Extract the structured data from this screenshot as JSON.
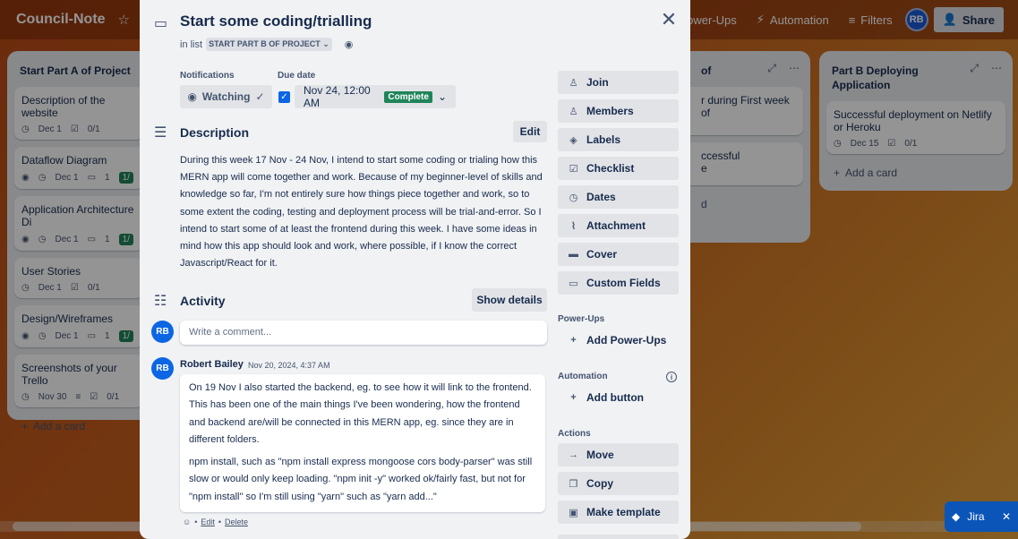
{
  "board": {
    "title": "Council-Note",
    "header_items": [
      "Power-Ups",
      "Automation",
      "Filters"
    ],
    "avatar": "RB",
    "share_label": "Share"
  },
  "lists": [
    {
      "title": "Start Part A of Project",
      "cards": [
        {
          "title": "Description of the website",
          "date": "Dec 1",
          "check": "0/1",
          "watch": false,
          "comments": "",
          "green": ""
        },
        {
          "title": "Dataflow Diagram",
          "date": "Dec 1",
          "check": "",
          "watch": true,
          "comments": "1",
          "green": "1/"
        },
        {
          "title": "Application Architecture Di",
          "date": "Dec 1",
          "check": "",
          "watch": true,
          "comments": "1",
          "green": "1/"
        },
        {
          "title": "User Stories",
          "date": "Dec 1",
          "check": "0/1",
          "watch": false,
          "comments": "",
          "green": ""
        },
        {
          "title": "Design/Wireframes",
          "date": "Dec 1",
          "check": "",
          "watch": true,
          "comments": "1",
          "green": "1/"
        },
        {
          "title": "Screenshots of your Trello",
          "date": "Nov 30",
          "check": "0/1",
          "watch": false,
          "comments": "",
          "green": ""
        }
      ],
      "add_card": "Add a card"
    },
    {
      "title": "of",
      "cards": [
        {
          "title": "r during First week of"
        },
        {
          "title": "ccessful\ne"
        }
      ],
      "add_card": "d"
    },
    {
      "title": "Part B Deploying Application",
      "cards": [
        {
          "title": "Successful deployment on Netlify or Heroku",
          "date": "Dec 15",
          "check": "0/1"
        }
      ],
      "add_card": "Add a card"
    }
  ],
  "jira": {
    "label": "Jira"
  },
  "modal": {
    "title": "Start some coding/trialling",
    "in_list_prefix": "in list",
    "list_name": "START PART B OF PROJECT",
    "notifications_label": "Notifications",
    "watching_label": "Watching",
    "due_label": "Due date",
    "due_value": "Nov 24, 12:00 AM",
    "due_status": "Complete",
    "description_title": "Description",
    "edit_label": "Edit",
    "description": "During this week 17 Nov - 24 Nov, I intend to start some coding or trialing how this MERN app will come together and work. Because of my beginner-level of skills and knowledge so far, I'm not entirely sure how things piece together and work, so to some extent the coding, testing and deployment process will be trial-and-error. So I intend to start some of at least the frontend during this week. I have some ideas in mind how this app should look and work, where possible, if I know the correct Javascript/React for it.",
    "activity_title": "Activity",
    "show_details_label": "Show details",
    "comment_placeholder": "Write a comment...",
    "avatar_initials": "RB",
    "comment": {
      "author": "Robert Bailey",
      "time": "Nov 20, 2024, 4:37 AM",
      "p1": "On 19 Nov I also started the backend, eg. to see how it will link to the frontend. This has been one of the main things I've been wondering, how the frontend and backend are/will be connected in this MERN app, eg. since they are in different folders.",
      "p2": "npm install, such as \"npm install express mongoose cors body-parser\" was still slow or would only keep loading. \"npm init -y\" worked ok/fairly fast, but not for \"npm install\" so I'm still using \"yarn\" such as \"yarn add...\"",
      "edit": "Edit",
      "delete": "Delete",
      "bullet": "•"
    },
    "sidebar": {
      "buttons": [
        "Join",
        "Members",
        "Labels",
        "Checklist",
        "Dates",
        "Attachment",
        "Cover",
        "Custom Fields"
      ],
      "powerups_title": "Power-Ups",
      "add_powerups": "Add Power-Ups",
      "automation_title": "Automation",
      "add_button": "Add button",
      "actions_title": "Actions",
      "actions": [
        "Move",
        "Copy",
        "Make template"
      ]
    }
  }
}
